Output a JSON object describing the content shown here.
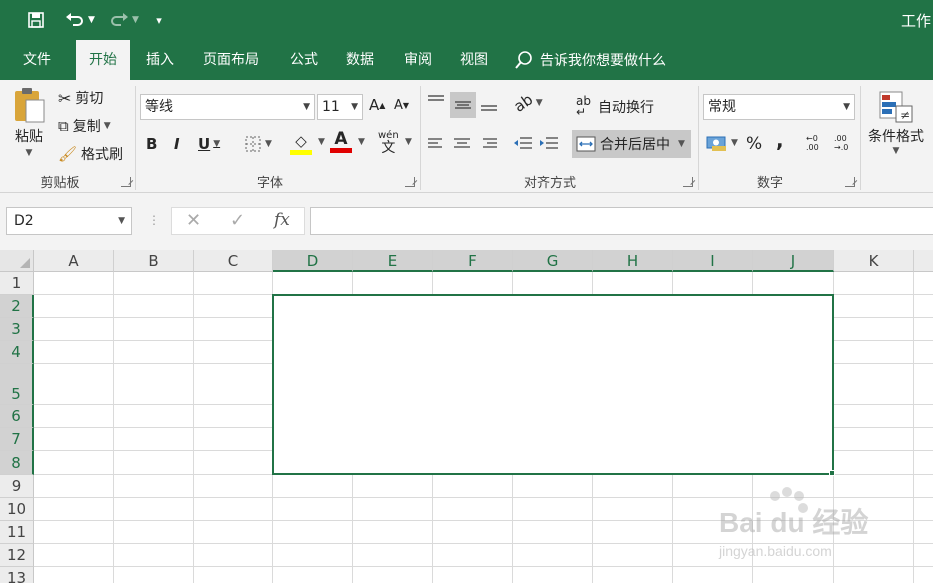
{
  "titlebar": {
    "title": "工作",
    "save_icon": "save-icon",
    "undo_icon": "undo-icon",
    "redo_icon": "redo-icon",
    "customize_icon": "customize-qat-icon"
  },
  "tabs": [
    "文件",
    "开始",
    "插入",
    "页面布局",
    "公式",
    "数据",
    "审阅",
    "视图"
  ],
  "active_tab": "开始",
  "tell_me": "告诉我你想要做什么",
  "clipboard": {
    "paste": "粘贴",
    "cut": "剪切",
    "copy": "复制",
    "format_painter": "格式刷",
    "label": "剪贴板"
  },
  "font": {
    "name": "等线",
    "size": "11",
    "grow": "A",
    "shrink": "A",
    "bold": "B",
    "italic": "I",
    "underline": "U",
    "phonetic": "wén",
    "label": "字体",
    "font_color": "#e00000",
    "fill_color": "#ffff00"
  },
  "alignment": {
    "wrap": "自动换行",
    "merge": "合并后居中",
    "label": "对齐方式"
  },
  "number": {
    "format": "常规",
    "percent": "%",
    "comma": ",",
    "label": "数字"
  },
  "styles": {
    "conditional": "条件格式"
  },
  "formula_bar": {
    "name_box": "D2",
    "cancel": "✕",
    "enter": "✓",
    "fx": "fx",
    "value": ""
  },
  "columns": [
    "A",
    "B",
    "C",
    "D",
    "E",
    "F",
    "G",
    "H",
    "I",
    "J",
    "K"
  ],
  "rows": [
    "1",
    "2",
    "3",
    "4",
    "5",
    "6",
    "7",
    "8",
    "9",
    "10",
    "11",
    "12",
    "13"
  ],
  "selection": {
    "range": "D2:J8",
    "merged": true
  },
  "watermark": {
    "brand": "Bai du 经验",
    "url": "jingyan.baidu.com"
  },
  "accent": "#217346"
}
